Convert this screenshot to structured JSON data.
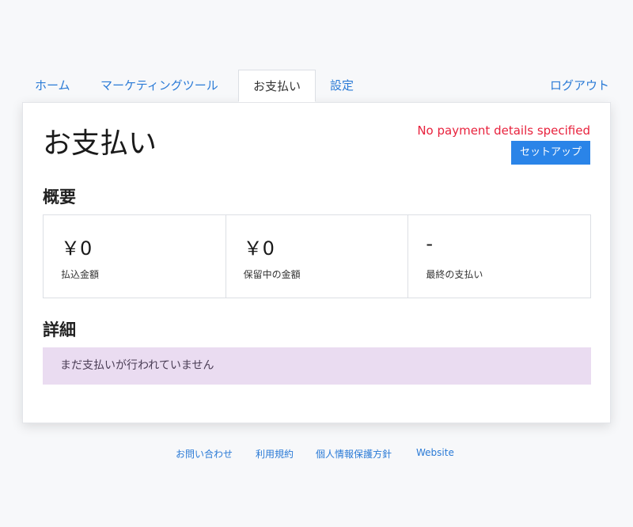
{
  "nav": {
    "home": "ホーム",
    "marketing": "マーケティングツール",
    "payments": "お支払い",
    "settings": "設定",
    "logout": "ログアウト"
  },
  "page": {
    "title": "お支払い",
    "warning": "No payment details specified",
    "setup_button": "セットアップ"
  },
  "summary": {
    "heading": "概要",
    "items": [
      {
        "value": "￥0",
        "label": "払込金額"
      },
      {
        "value": "￥0",
        "label": "保留中の金額"
      },
      {
        "value": "-",
        "label": "最終の支払い"
      }
    ]
  },
  "details": {
    "heading": "詳細",
    "empty_message": "まだ支払いが行われていません"
  },
  "footer": {
    "contact": "お問い合わせ",
    "terms": "利用規約",
    "privacy": "個人情報保護方針",
    "website": "Website"
  },
  "colors": {
    "link": "#2a7ad6",
    "accent_button": "#2a84e8",
    "warning": "#e8223d",
    "empty_bg": "#eadcf1"
  }
}
